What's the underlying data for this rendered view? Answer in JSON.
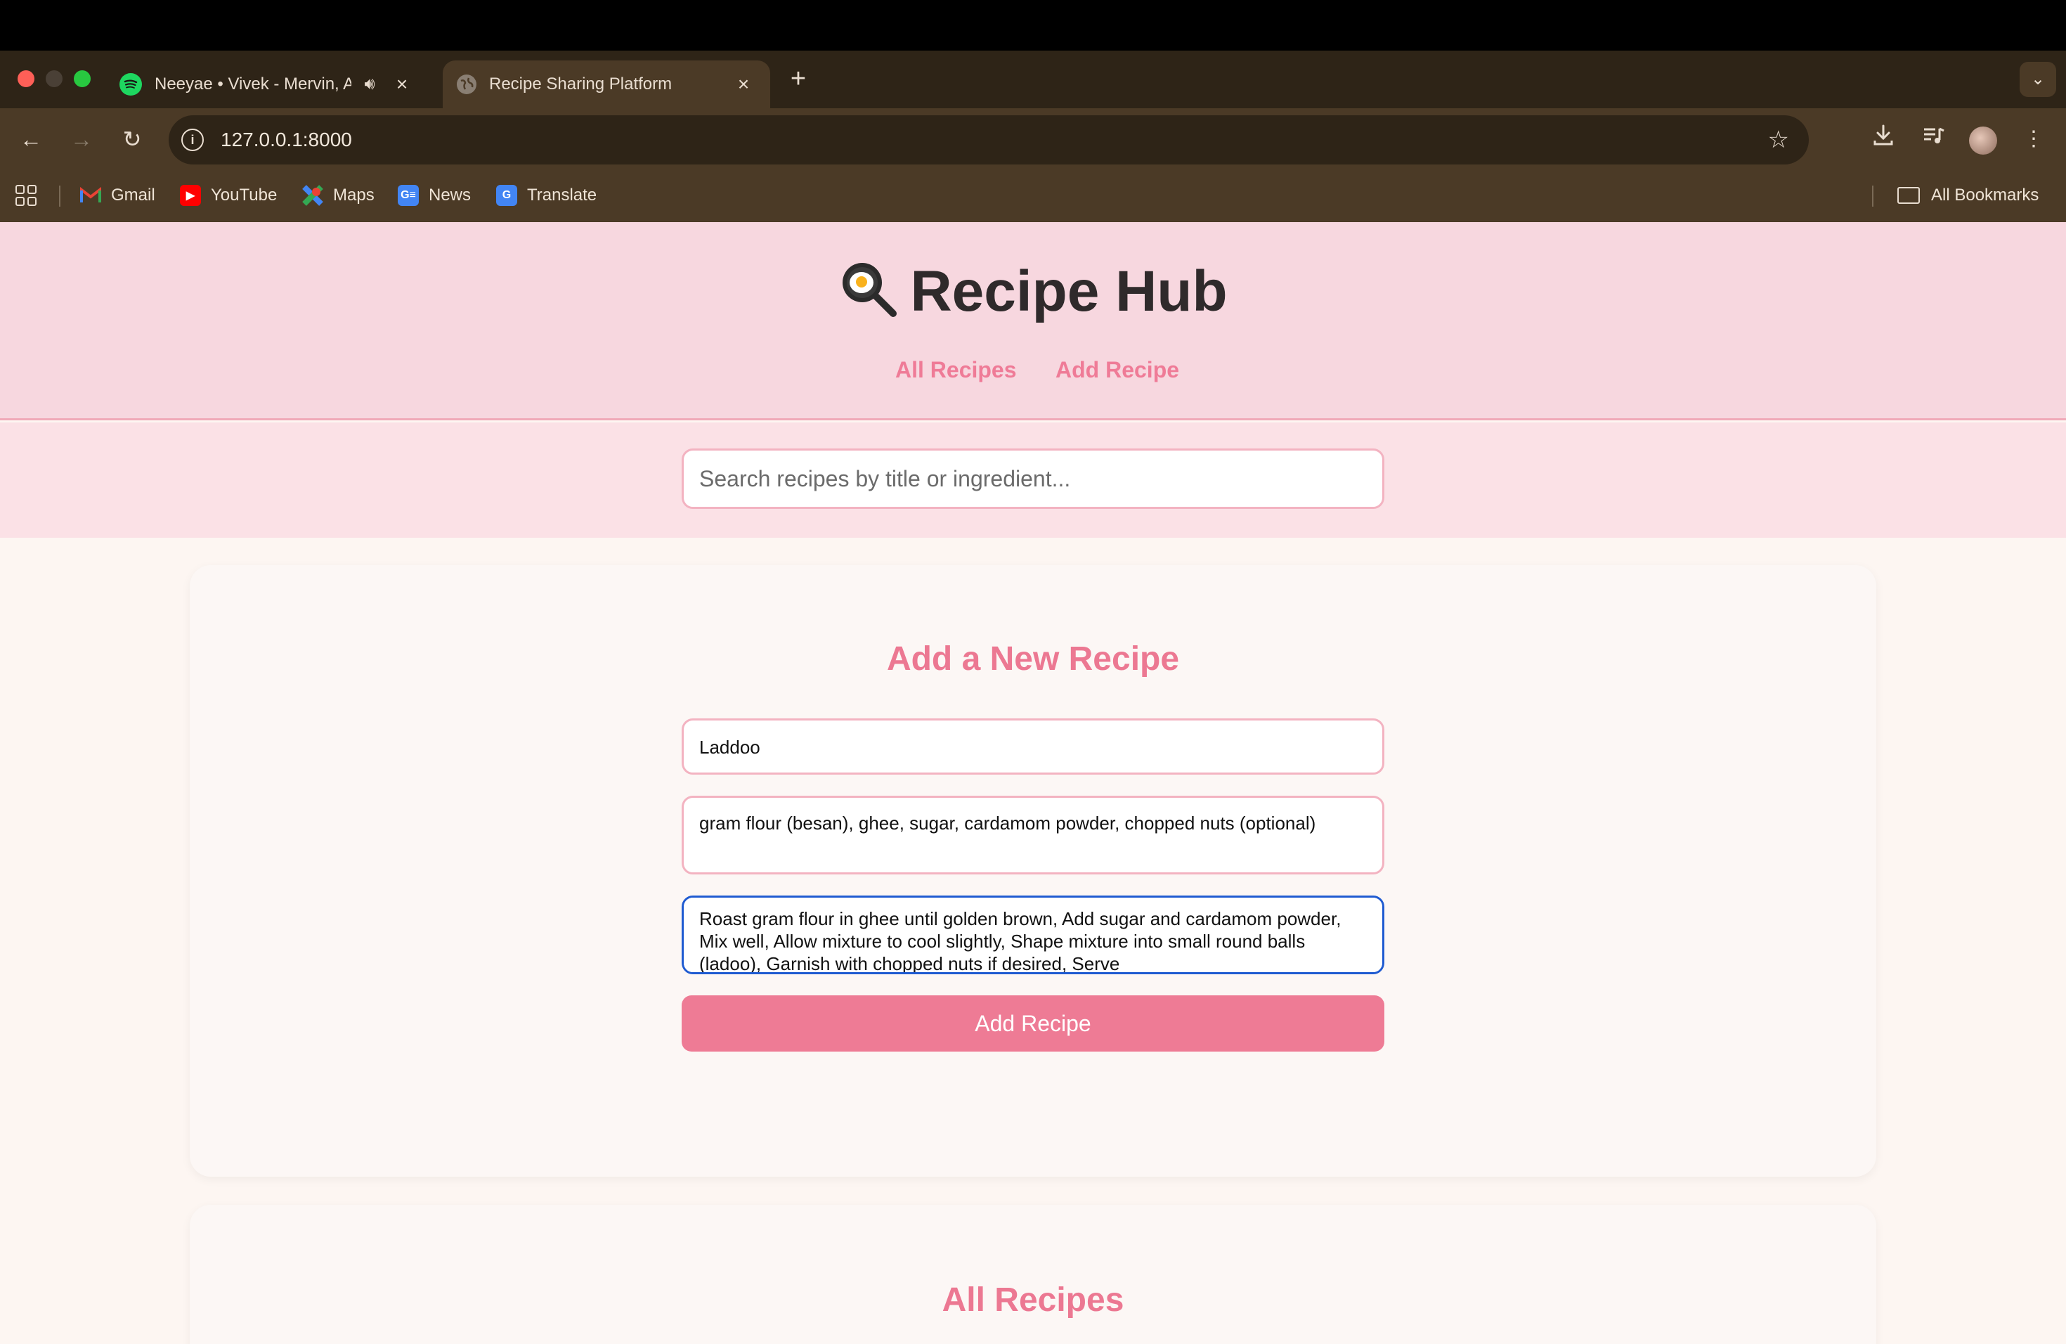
{
  "browser": {
    "tabs": [
      {
        "title": "Neeyae • Vivek - Mervin, A",
        "active": false,
        "playing_audio": true
      },
      {
        "title": "Recipe Sharing Platform",
        "active": true
      }
    ],
    "address": "127.0.0.1:8000",
    "bookmarks": [
      {
        "label": "Gmail",
        "icon": "gmail-icon"
      },
      {
        "label": "YouTube",
        "icon": "youtube-icon"
      },
      {
        "label": "Maps",
        "icon": "maps-icon"
      },
      {
        "label": "News",
        "icon": "news-icon"
      },
      {
        "label": "Translate",
        "icon": "translate-icon"
      }
    ],
    "all_bookmarks": "All Bookmarks"
  },
  "site": {
    "logo_emoji": "🍳",
    "title": "Recipe Hub",
    "nav": [
      "All Recipes",
      "Add Recipe"
    ],
    "search_placeholder": "Search recipes by title or ingredient..."
  },
  "form": {
    "heading": "Add a New Recipe",
    "title_value": "Laddoo",
    "ingredients_value": "gram flour (besan), ghee, sugar, cardamom powder, chopped nuts (optional)",
    "steps_value": "Roast gram flour in ghee until golden brown, Add sugar and cardamom powder, Mix well, Allow mixture to cool slightly, Shape mixture into small round balls (ladoo), Garnish with chopped nuts if desired, Serve",
    "submit_label": "Add Recipe"
  },
  "list": {
    "heading": "All Recipes"
  },
  "colors": {
    "accent": "#ee7b95",
    "header_bg": "#f7d7df",
    "focus_border": "#1f5bd1"
  }
}
